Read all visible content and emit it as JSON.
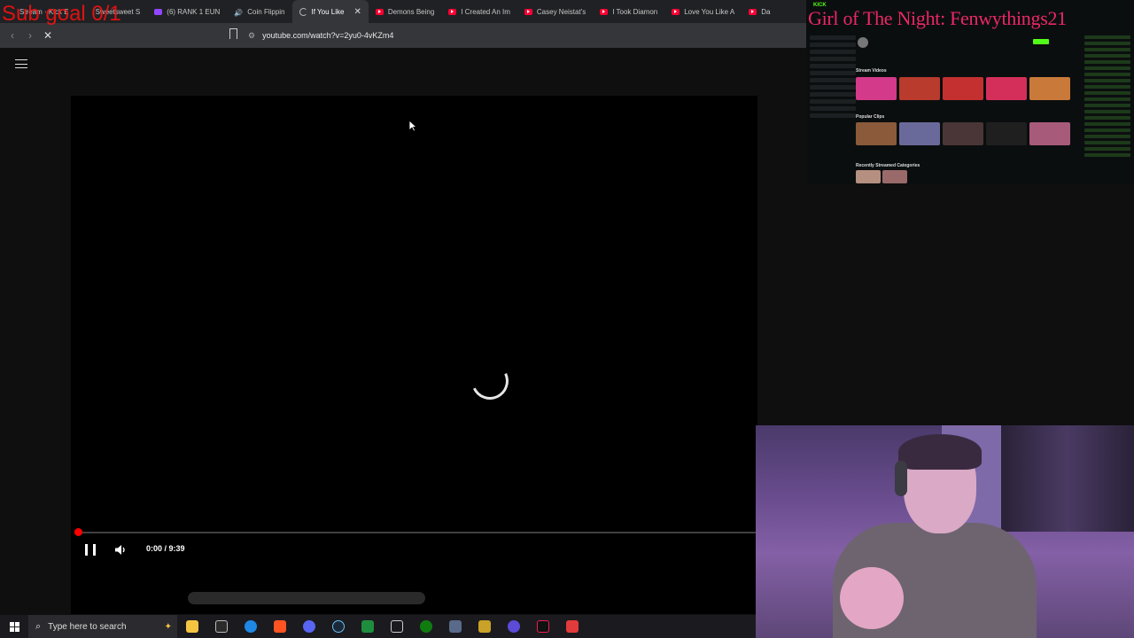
{
  "browser": {
    "tabs": [
      {
        "label": "Stream · Kick E",
        "favicon": "kick-icon"
      },
      {
        "label": "Sweetsweet S",
        "favicon": "kick-icon"
      },
      {
        "label": "(6) RANK 1 EUN",
        "favicon": "twitch-icon"
      },
      {
        "label": "Coin Flippin",
        "favicon": "speaker-icon"
      },
      {
        "label": "If You Like",
        "favicon": "loading-icon",
        "active": true
      },
      {
        "label": "Demons Being",
        "favicon": "youtube-icon"
      },
      {
        "label": "I Created An Im",
        "favicon": "youtube-icon"
      },
      {
        "label": "Casey Neistat's",
        "favicon": "youtube-icon"
      },
      {
        "label": "I Took Diamon",
        "favicon": "youtube-icon"
      },
      {
        "label": "Love You Like A",
        "favicon": "youtube-icon"
      },
      {
        "label": "Da",
        "favicon": "youtube-icon"
      }
    ],
    "close_glyph": "✕",
    "url": "youtube.com/watch?v=2yu0-4vKZm4"
  },
  "player": {
    "time_current": "0:00",
    "time_separator": " / ",
    "time_total": "9:39",
    "progress_fraction": 0.0,
    "state": "loading"
  },
  "overlays": {
    "sub_goal": "Sub goal 0/1",
    "title": "Girl of The Night: Fenwythings21"
  },
  "kick_panel": {
    "brand": "KICK",
    "section_videos": "Stream Videos",
    "section_clips": "Popular Clips",
    "section_categories": "Recently Streamed Categories"
  },
  "taskbar": {
    "search_placeholder": "Type here to search",
    "apps": [
      "file-explorer-icon",
      "epic-games-icon",
      "edge-icon",
      "brave-icon",
      "discord-icon",
      "steam-icon",
      "spreadsheet-icon",
      "window-icon",
      "xbox-icon",
      "shield-icon",
      "pen-icon",
      "video-icon",
      "tiktok-icon",
      "app-icon"
    ]
  },
  "colors": {
    "accent_red": "#ff0000",
    "kick_green": "#53fc18",
    "overlay_pink": "#ff2a6d"
  }
}
